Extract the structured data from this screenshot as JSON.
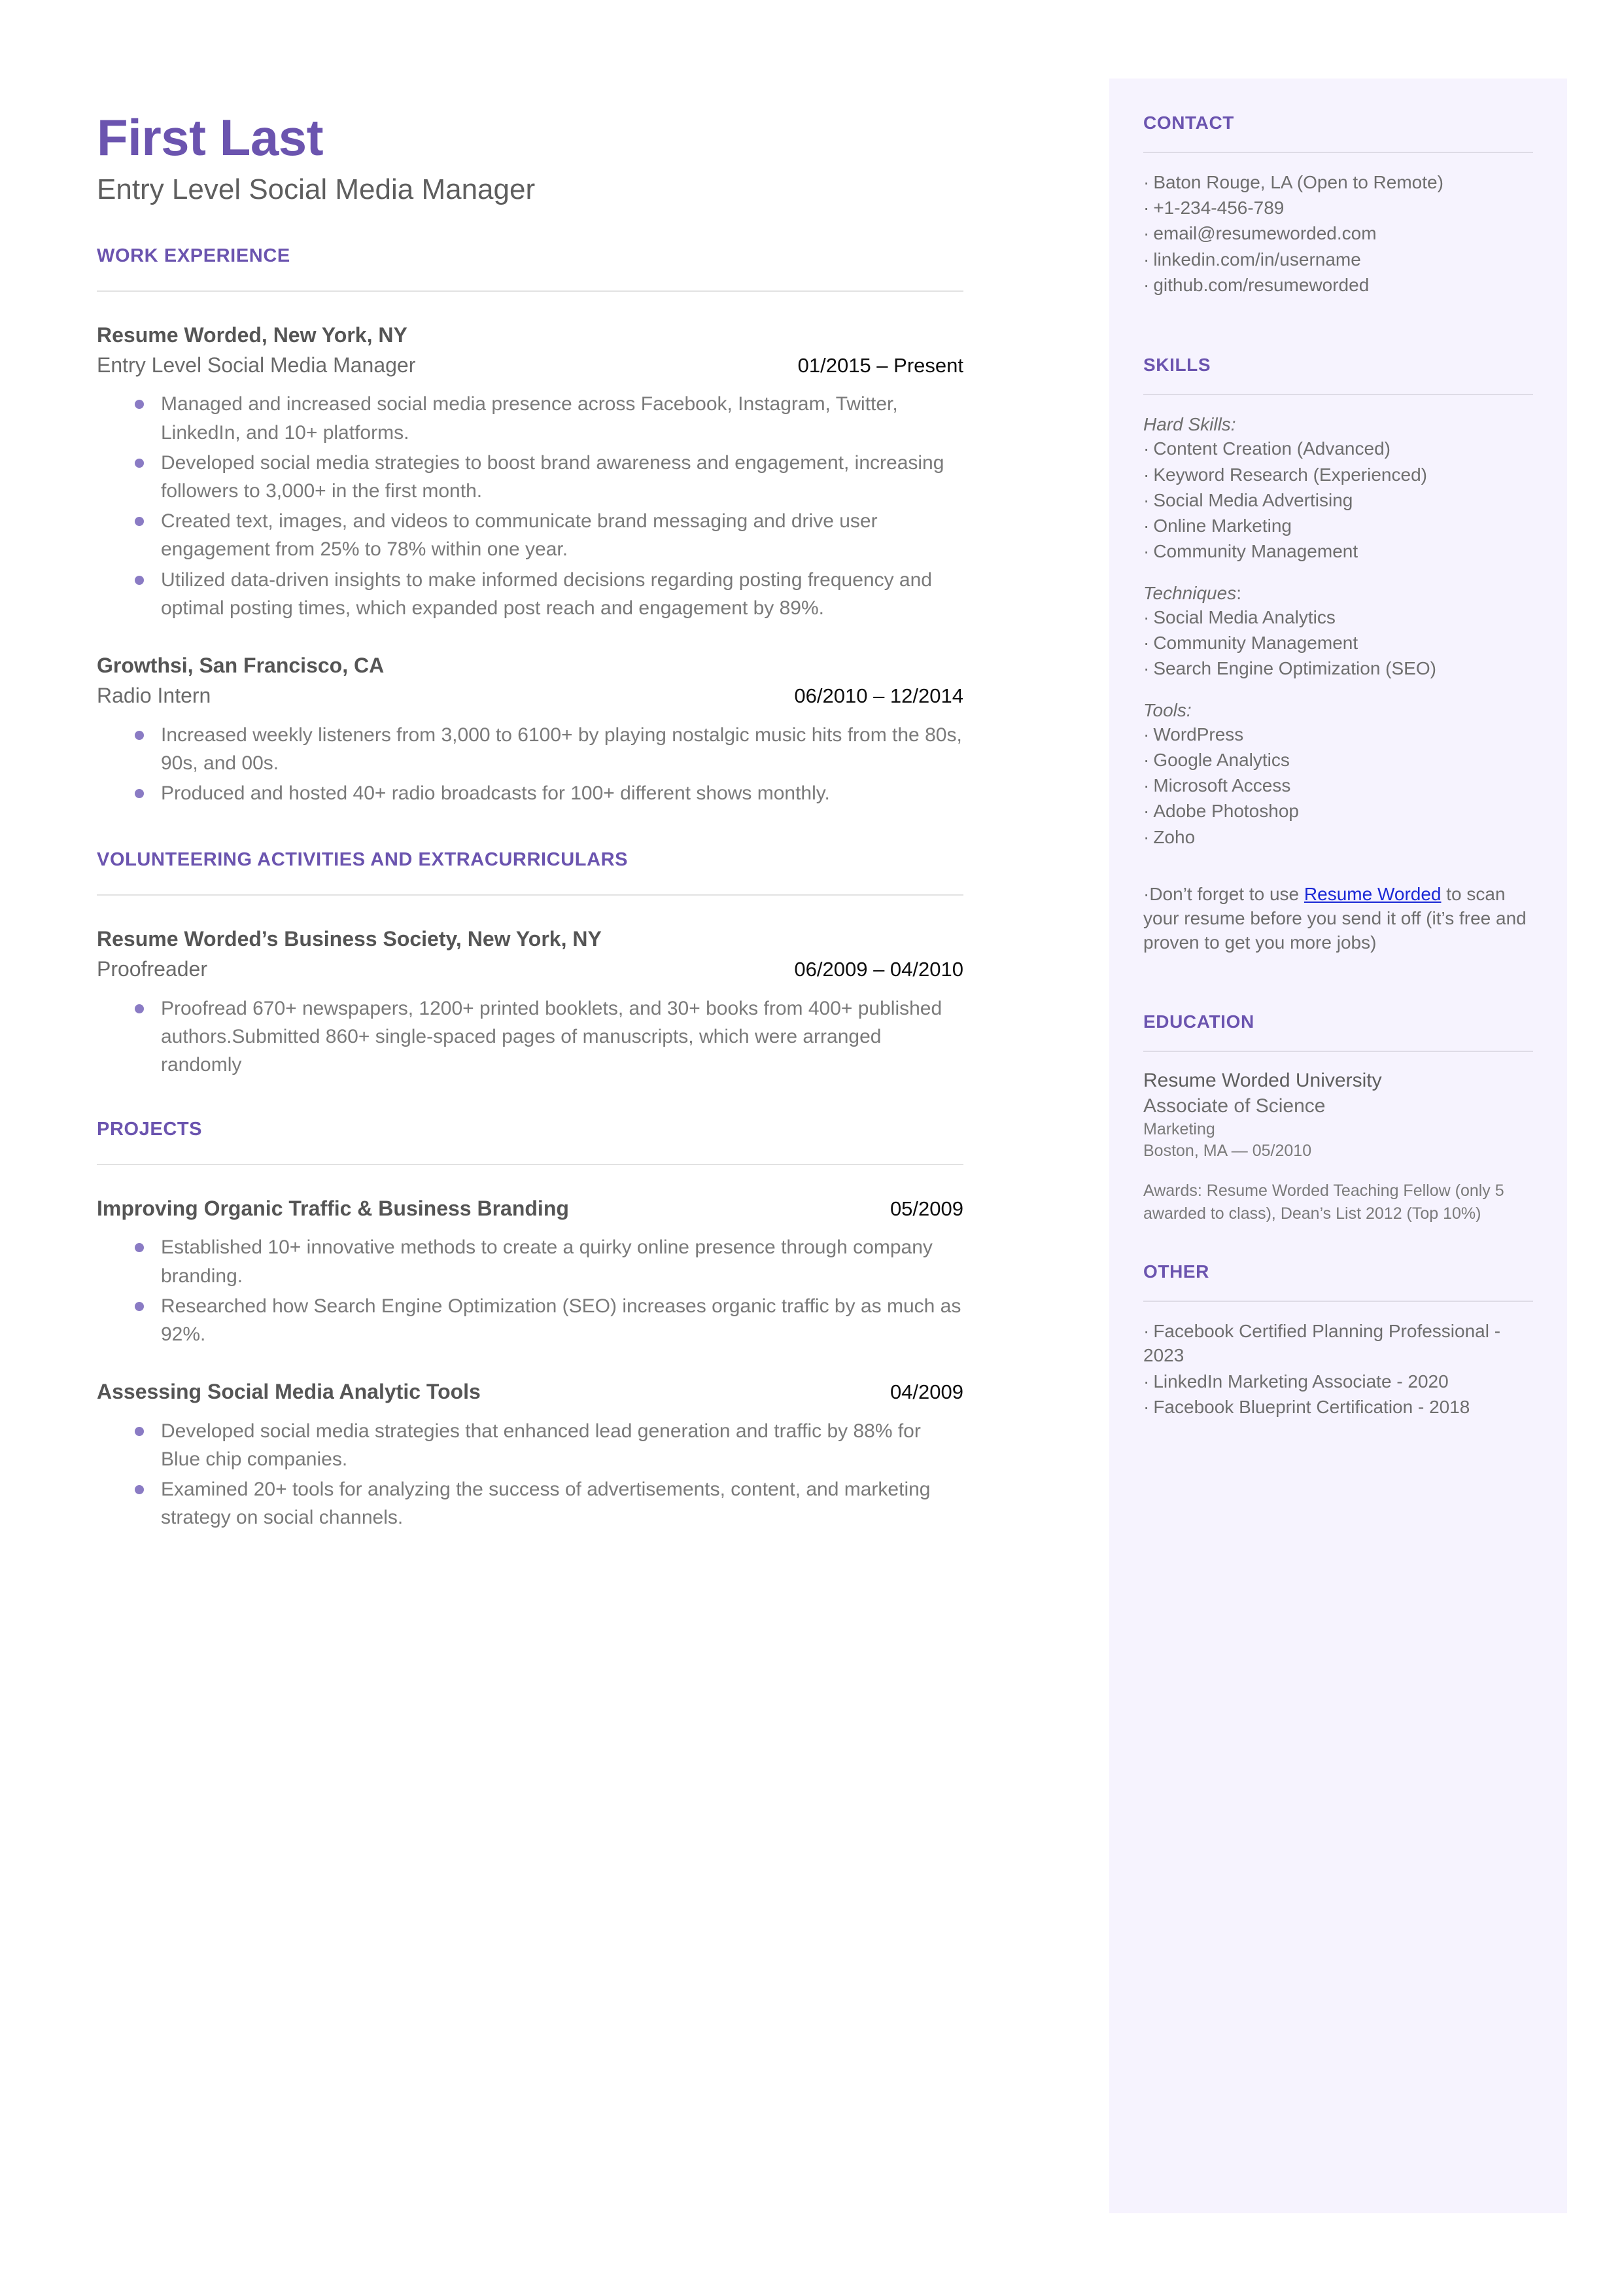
{
  "header": {
    "name": "First Last",
    "headline": "Entry Level Social Media Manager"
  },
  "sections": {
    "work_experience_title": "WORK EXPERIENCE",
    "volunteering_title": "VOLUNTEERING ACTIVITIES AND EXTRACURRICULARS",
    "projects_title": "PROJECTS"
  },
  "work_experience": [
    {
      "organization": "Resume Worded, New York, NY",
      "role": "Entry Level Social Media Manager",
      "date": "01/2015 – Present",
      "bullets": [
        "Managed and increased social media presence across Facebook, Instagram, Twitter, LinkedIn, and 10+ platforms.",
        "Developed social media strategies to boost brand awareness and engagement, increasing followers to 3,000+ in the first month.",
        "Created text, images, and videos to communicate brand messaging and drive user engagement from 25% to 78% within one year.",
        "Utilized data-driven insights to make informed decisions regarding posting frequency and optimal posting times, which expanded post reach and engagement by 89%."
      ]
    },
    {
      "organization": "Growthsi, San Francisco, CA",
      "role": "Radio Intern",
      "date": "06/2010 – 12/2014",
      "bullets": [
        "Increased weekly listeners from 3,000 to 6100+ by playing nostalgic music hits from the 80s, 90s, and 00s.",
        "Produced and hosted 40+ radio broadcasts for 100+ different shows monthly."
      ]
    }
  ],
  "volunteering": [
    {
      "organization": "Resume Worded’s Business Society, New York, NY",
      "role": "Proofreader",
      "date": "06/2009 – 04/2010",
      "bullets": [
        "Proofread 670+ newspapers, 1200+ printed booklets, and 30+ books from 400+ published authors.Submitted 860+ single-spaced pages of manuscripts, which were arranged randomly"
      ]
    }
  ],
  "projects": [
    {
      "title": "Improving Organic Traffic & Business Branding",
      "date": "05/2009",
      "bullets": [
        "Established 10+ innovative methods to create a quirky online presence through company branding.",
        "Researched how Search Engine Optimization (SEO) increases organic traffic by as much as 92%."
      ]
    },
    {
      "title": "Assessing Social Media Analytic Tools",
      "date": "04/2009",
      "bullets": [
        "Developed social media strategies that enhanced lead generation and traffic by 88% for Blue chip companies.",
        "Examined 20+ tools for analyzing the success of advertisements, content, and marketing strategy on social channels."
      ]
    }
  ],
  "sidebar": {
    "contact": {
      "title": "CONTACT",
      "items": [
        "Baton Rouge, LA (Open to Remote)",
        "+1-234-456-789",
        "email@resumeworded.com",
        "linkedin.com/in/username",
        "github.com/resumeworded"
      ]
    },
    "skills": {
      "title": "SKILLS",
      "groups": [
        {
          "label": "Hard Skills:",
          "items": [
            "Content Creation (Advanced)",
            "Keyword Research (Experienced)",
            "Social Media Advertising",
            "Online Marketing",
            "Community Management"
          ]
        },
        {
          "label": "Techniques",
          "label_suffix": ":",
          "items": [
            "Social Media Analytics",
            "Community Management",
            "Search Engine Optimization (SEO)"
          ]
        },
        {
          "label": "Tools:",
          "items": [
            "WordPress",
            "Google Analytics",
            "Microsoft Access",
            "Adobe Photoshop",
            "Zoho"
          ]
        }
      ],
      "note": {
        "prefix": "Don’t forget to use ",
        "link": "Resume Worded",
        "suffix": " to scan your resume before you send it off (it’s free and proven to get you more jobs)"
      }
    },
    "education": {
      "title": "EDUCATION",
      "school": "Resume Worded University",
      "degree": "Associate of Science",
      "major": "Marketing",
      "location_date": "Boston, MA — 05/2010",
      "awards": "Awards: Resume Worded Teaching Fellow (only 5 awarded to class), Dean’s List 2012 (Top 10%)"
    },
    "other": {
      "title": "OTHER",
      "items": [
        "Facebook Certified Planning Professional - 2023",
        "LinkedIn Marketing Associate - 2020",
        "Facebook Blueprint Certification - 2018"
      ]
    }
  },
  "colors": {
    "accent": "#6b54af",
    "sidebar_bg": "#f6f3fe",
    "bullet": "#8a7bc4",
    "link": "#1a28d6",
    "body_text": "#7a7a7a"
  }
}
